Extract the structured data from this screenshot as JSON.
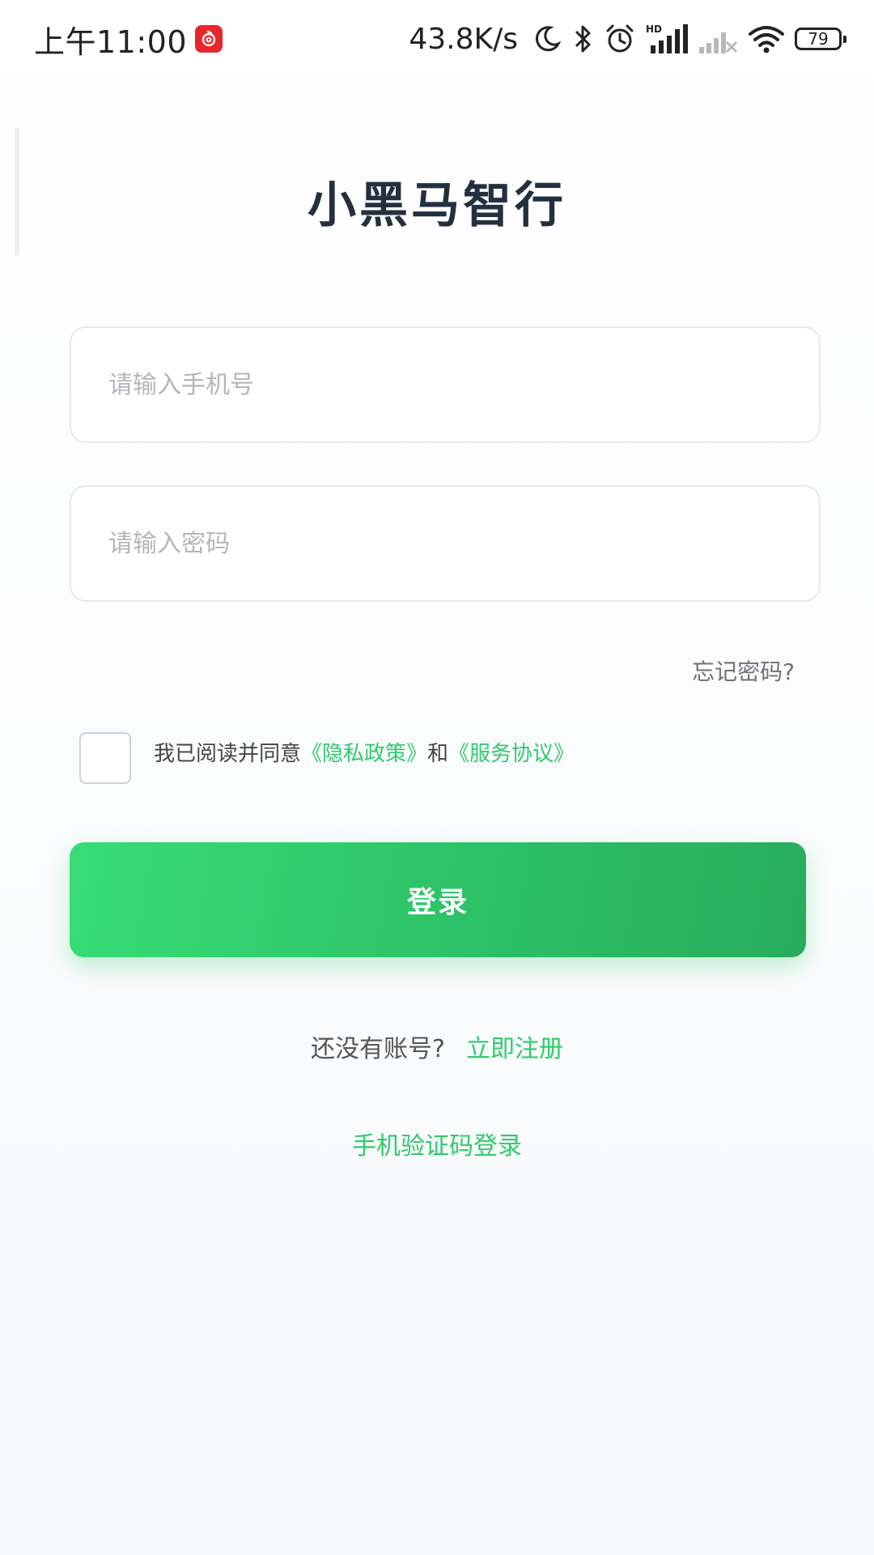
{
  "status_bar": {
    "time": "上午11:00",
    "net_speed": "43.8K/s",
    "battery": "79",
    "icons": [
      "netease-music-icon",
      "moon-icon",
      "bluetooth-icon",
      "alarm-icon",
      "hd-signal-icon",
      "signal-no-sim-icon",
      "wifi-icon",
      "battery-icon"
    ]
  },
  "app": {
    "title": "小黑马智行"
  },
  "form": {
    "phone_placeholder": "请输入手机号",
    "password_placeholder": "请输入密码",
    "forgot_password": "忘记密码?",
    "agree_prefix": "我已阅读并同意",
    "privacy_link": "《隐私政策》",
    "agree_and": "和",
    "service_link": "《服务协议》",
    "login_button": "登录"
  },
  "footer": {
    "no_account": "还没有账号?",
    "register_link": "立即注册",
    "sms_login": "手机验证码登录"
  },
  "colors": {
    "accent_green": "#2fcb6b",
    "title_color": "#23303f"
  }
}
